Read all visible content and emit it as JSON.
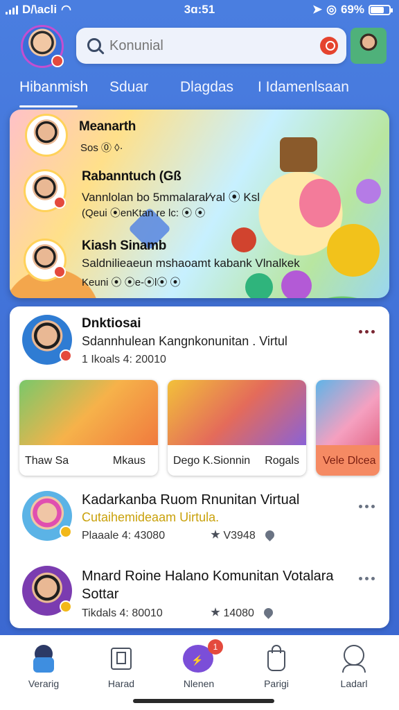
{
  "status_bar": {
    "carrier": "D/\\acli",
    "time": "3ɑ:51",
    "battery": "69%",
    "battery_level": 0.69
  },
  "search": {
    "placeholder": "Konunial"
  },
  "tabs": [
    "Hibanmish",
    "Sduar",
    "Dlagdas",
    "I Idamenlsaan"
  ],
  "hero": {
    "items": [
      {
        "name": "Meanarth",
        "meta": "Sos ⓪ ◊·"
      },
      {
        "name": "Rabanntuch (Gß",
        "desc": "Vannlolan bo 5mmalaral⁄ʏal ⦿ Ksl",
        "meta": "(Qeui ⦿enKtan re lc: ⦿ ⦿"
      },
      {
        "name": "Kiash Sinamb",
        "desc": "Saldnilieaeun mshaoamt kabank Vlnalkek",
        "meta": "Keuni ⦿ ⦿e-⦿l⦿ ⦿"
      }
    ]
  },
  "feed": {
    "post": {
      "title": "Dnktiosai",
      "desc": "Sdannhulean Kangnkonunitan . Virtul",
      "meta": "1 Ikoals 4: 20010"
    },
    "thumbs": [
      {
        "left": "Thaw Sa",
        "right": "Mkaus"
      },
      {
        "left": "Dego K.Sionnin",
        "right": "Rogals"
      },
      {
        "left": "Vele Dlcea",
        "right": ""
      }
    ],
    "list": [
      {
        "title": "Kadarkanba Ruom Rnunitan Virtual",
        "sub": "Cutaihemideaam Uirtula.",
        "meta": "Plaaale 4: 43080",
        "stat": "V3948"
      },
      {
        "title": "Mnard Roine Halano Komunitan Votalara",
        "title2": "Sottar",
        "meta": "Tikdals 4: 80010",
        "stat": "14080"
      }
    ]
  },
  "nav": [
    "Verarig",
    "Harad",
    "Nlenen",
    "Parigi",
    "Ladarl"
  ],
  "nav_badge": "1",
  "colors": {
    "accent": "#3f6fd6",
    "badge": "#e44a3d",
    "highlight": "#f58a63"
  }
}
